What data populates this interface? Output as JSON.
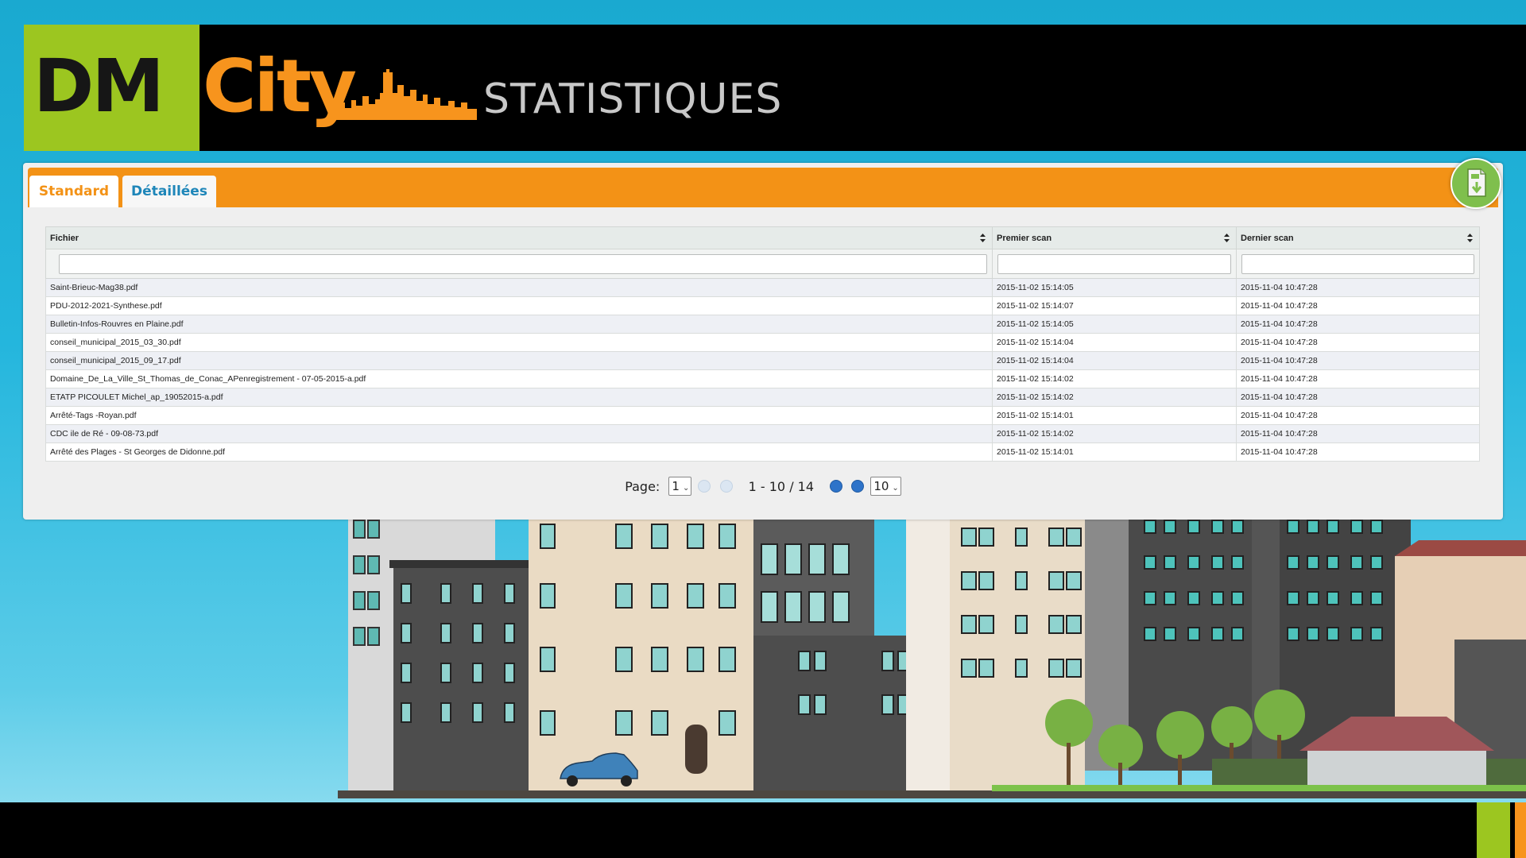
{
  "header": {
    "logo_dm": "DM",
    "logo_city": "City",
    "title": "STATISTIQUES"
  },
  "tabs": [
    {
      "label": "Standard",
      "active": true
    },
    {
      "label": "Détaillées",
      "active": false
    }
  ],
  "export": {
    "icon": "csv-download-icon",
    "label": "CSV"
  },
  "table": {
    "columns": [
      "Fichier",
      "Premier scan",
      "Dernier scan"
    ],
    "rows": [
      [
        "Saint-Brieuc-Mag38.pdf",
        "2015-11-02 15:14:05",
        "2015-11-04 10:47:28"
      ],
      [
        "PDU-2012-2021-Synthese.pdf",
        "2015-11-02 15:14:07",
        "2015-11-04 10:47:28"
      ],
      [
        "Bulletin-Infos-Rouvres en Plaine.pdf",
        "2015-11-02 15:14:05",
        "2015-11-04 10:47:28"
      ],
      [
        "conseil_municipal_2015_03_30.pdf",
        "2015-11-02 15:14:04",
        "2015-11-04 10:47:28"
      ],
      [
        "conseil_municipal_2015_09_17.pdf",
        "2015-11-02 15:14:04",
        "2015-11-04 10:47:28"
      ],
      [
        "Domaine_De_La_Ville_St_Thomas_de_Conac_APenregistrement - 07-05-2015-a.pdf",
        "2015-11-02 15:14:02",
        "2015-11-04 10:47:28"
      ],
      [
        "ETATP PICOULET Michel_ap_19052015-a.pdf",
        "2015-11-02 15:14:02",
        "2015-11-04 10:47:28"
      ],
      [
        "Arrêté-Tags -Royan.pdf",
        "2015-11-02 15:14:01",
        "2015-11-04 10:47:28"
      ],
      [
        "CDC ile de Ré - 09-08-73.pdf",
        "2015-11-02 15:14:02",
        "2015-11-04 10:47:28"
      ],
      [
        "Arrêté des Plages - St Georges de Didonne.pdf",
        "2015-11-02 15:14:01",
        "2015-11-04 10:47:28"
      ]
    ]
  },
  "pager": {
    "label": "Page:",
    "page": "1",
    "range": "1 - 10 / 14",
    "per_page": "10"
  },
  "colors": {
    "accent_orange": "#f39216",
    "brand_green": "#9cc620",
    "tab_blue": "#1e86b9"
  }
}
